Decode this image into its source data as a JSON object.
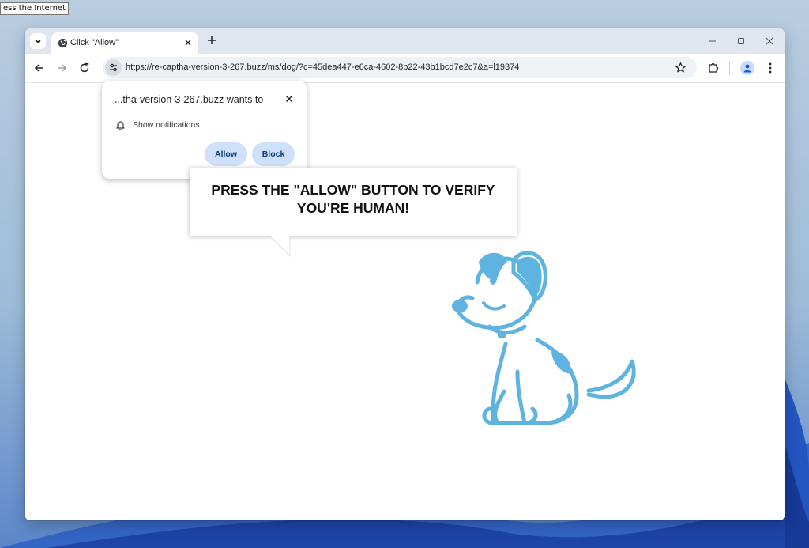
{
  "desktop": {
    "tooltip": "ess the Internet",
    "accent_color": "#3b6fd4"
  },
  "browser": {
    "tab_search_icon": "chevron-down-icon",
    "tab": {
      "title": "Click \"Allow\"",
      "favicon": "globe-icon",
      "close_icon": "close-icon"
    },
    "new_tab_icon": "plus-icon",
    "window_controls": [
      "minimize-icon",
      "maximize-icon",
      "close-icon"
    ],
    "toolbar": {
      "back_icon": "arrow-left-icon",
      "forward_icon": "arrow-right-icon",
      "reload_icon": "reload-icon",
      "site_info_icon": "tune-icon",
      "url": "https://re-captha-version-3-267.buzz/ms/dog/?c=45dea447-e6ca-4602-8b22-43b1bcd7e2c7&a=l19374",
      "bookmark_icon": "star-icon",
      "extensions_icon": "puzzle-icon",
      "profile_icon": "person-icon",
      "menu_icon": "kebab-menu-icon"
    }
  },
  "permission_prompt": {
    "title": "...tha-version-3-267.buzz wants to",
    "permission_label": "Show notifications",
    "permission_icon": "bell-icon",
    "allow_label": "Allow",
    "block_label": "Block",
    "button_color": "#cfe0fb"
  },
  "page": {
    "message_line1": "PRESS THE \"ALLOW\" BUTTON TO VERIFY",
    "message_line2": "YOU'RE HUMAN!",
    "illustration": "dog-illustration",
    "dog_color": "#5eb3e0"
  }
}
